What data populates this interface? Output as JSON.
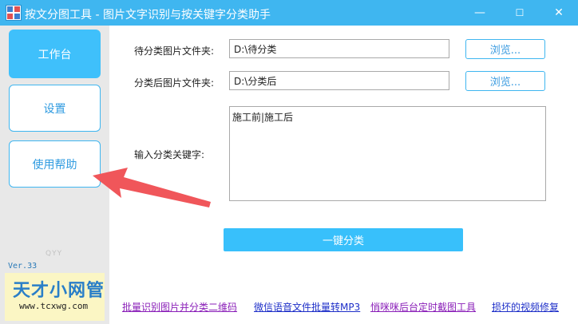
{
  "window": {
    "title": "按文分图工具 - 图片文字识别与按关键字分类助手",
    "minimize_glyph": "—",
    "maximize_glyph": "☐",
    "close_glyph": "✕"
  },
  "sidebar": {
    "items": [
      {
        "label": "工作台",
        "active": true
      },
      {
        "label": "设置",
        "active": false
      },
      {
        "label": "使用帮助",
        "active": false
      }
    ],
    "watermark": "QYY",
    "version": "Ver.33",
    "brand": {
      "name": "天才小网管",
      "url": "www.tcxwg.com"
    }
  },
  "form": {
    "source_label": "待分类图片文件夹:",
    "source_value": "D:\\待分类",
    "target_label": "分类后图片文件夹:",
    "target_value": "D:\\分类后",
    "browse_label": "浏览...",
    "keyword_label": "输入分类关键字:",
    "keyword_value": "施工前|施工后",
    "classify_button": "一键分类"
  },
  "footer": {
    "links": [
      {
        "text": "批量识别图片并分类二维码",
        "color": "#8a1fb8"
      },
      {
        "text": "微信语音文件批量转MP3",
        "color": "#1e2fc8"
      },
      {
        "text": "悄咪咪后台定时截图工具",
        "color": "#8a1fb8"
      },
      {
        "text": "损坏的视频修复",
        "color": "#1e2fc8"
      }
    ]
  },
  "colors": {
    "accent": "#3fc0fb",
    "title_bar": "#3fb6f0",
    "annotation_arrow": "#f0565a"
  },
  "icons": {
    "app": "app-logo-icon",
    "annotation": "red-arrow-annotation"
  }
}
